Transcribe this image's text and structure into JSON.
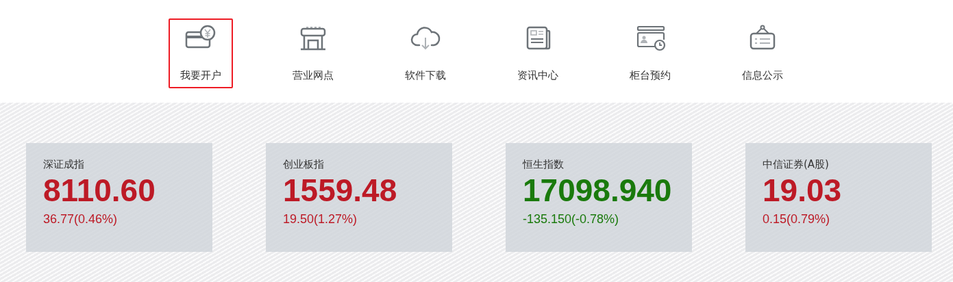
{
  "nav": [
    {
      "label": "我要开户",
      "selected": true
    },
    {
      "label": "营业网点",
      "selected": false
    },
    {
      "label": "软件下载",
      "selected": false
    },
    {
      "label": "资讯中心",
      "selected": false
    },
    {
      "label": "柜台预约",
      "selected": false
    },
    {
      "label": "信息公示",
      "selected": false
    }
  ],
  "quotes": [
    {
      "name": "深证成指",
      "value": "8110.60",
      "change": "36.77(0.46%)",
      "color": "#bd1a26"
    },
    {
      "name": "创业板指",
      "value": "1559.48",
      "change": "19.50(1.27%)",
      "color": "#bd1a26"
    },
    {
      "name": "恒生指数",
      "value": "17098.940",
      "change": "-135.150(-0.78%)",
      "color": "#1a7a0c"
    },
    {
      "name": "中信证券(A股)",
      "value": "19.03",
      "change": "0.15(0.79%)",
      "color": "#bd1a26"
    }
  ]
}
